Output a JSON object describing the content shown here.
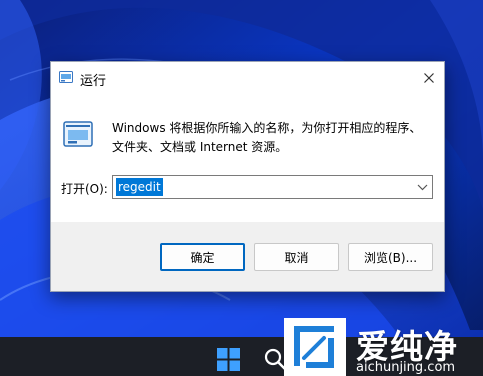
{
  "dialog": {
    "title": "运行",
    "description": "Windows 将根据你所输入的名称，为你打开相应的程序、文件夹、文档或 Internet 资源。",
    "open_label": "打开(O):",
    "command_value": "regedit",
    "buttons": {
      "ok": "确定",
      "cancel": "取消",
      "browse": "浏览(B)..."
    }
  },
  "icons": {
    "title": "run-icon",
    "content": "run-icon",
    "close": "close-icon",
    "dropdown": "chevron-down-icon",
    "start": "windows-start-icon",
    "search": "search-icon"
  },
  "watermark": {
    "brand": "爱纯净",
    "url": "aichunjing.com"
  },
  "colors": {
    "accent": "#0067c0",
    "selection": "#0078d7",
    "wallpaper": "#0a1f6e",
    "taskbar": "#1c1f26"
  }
}
